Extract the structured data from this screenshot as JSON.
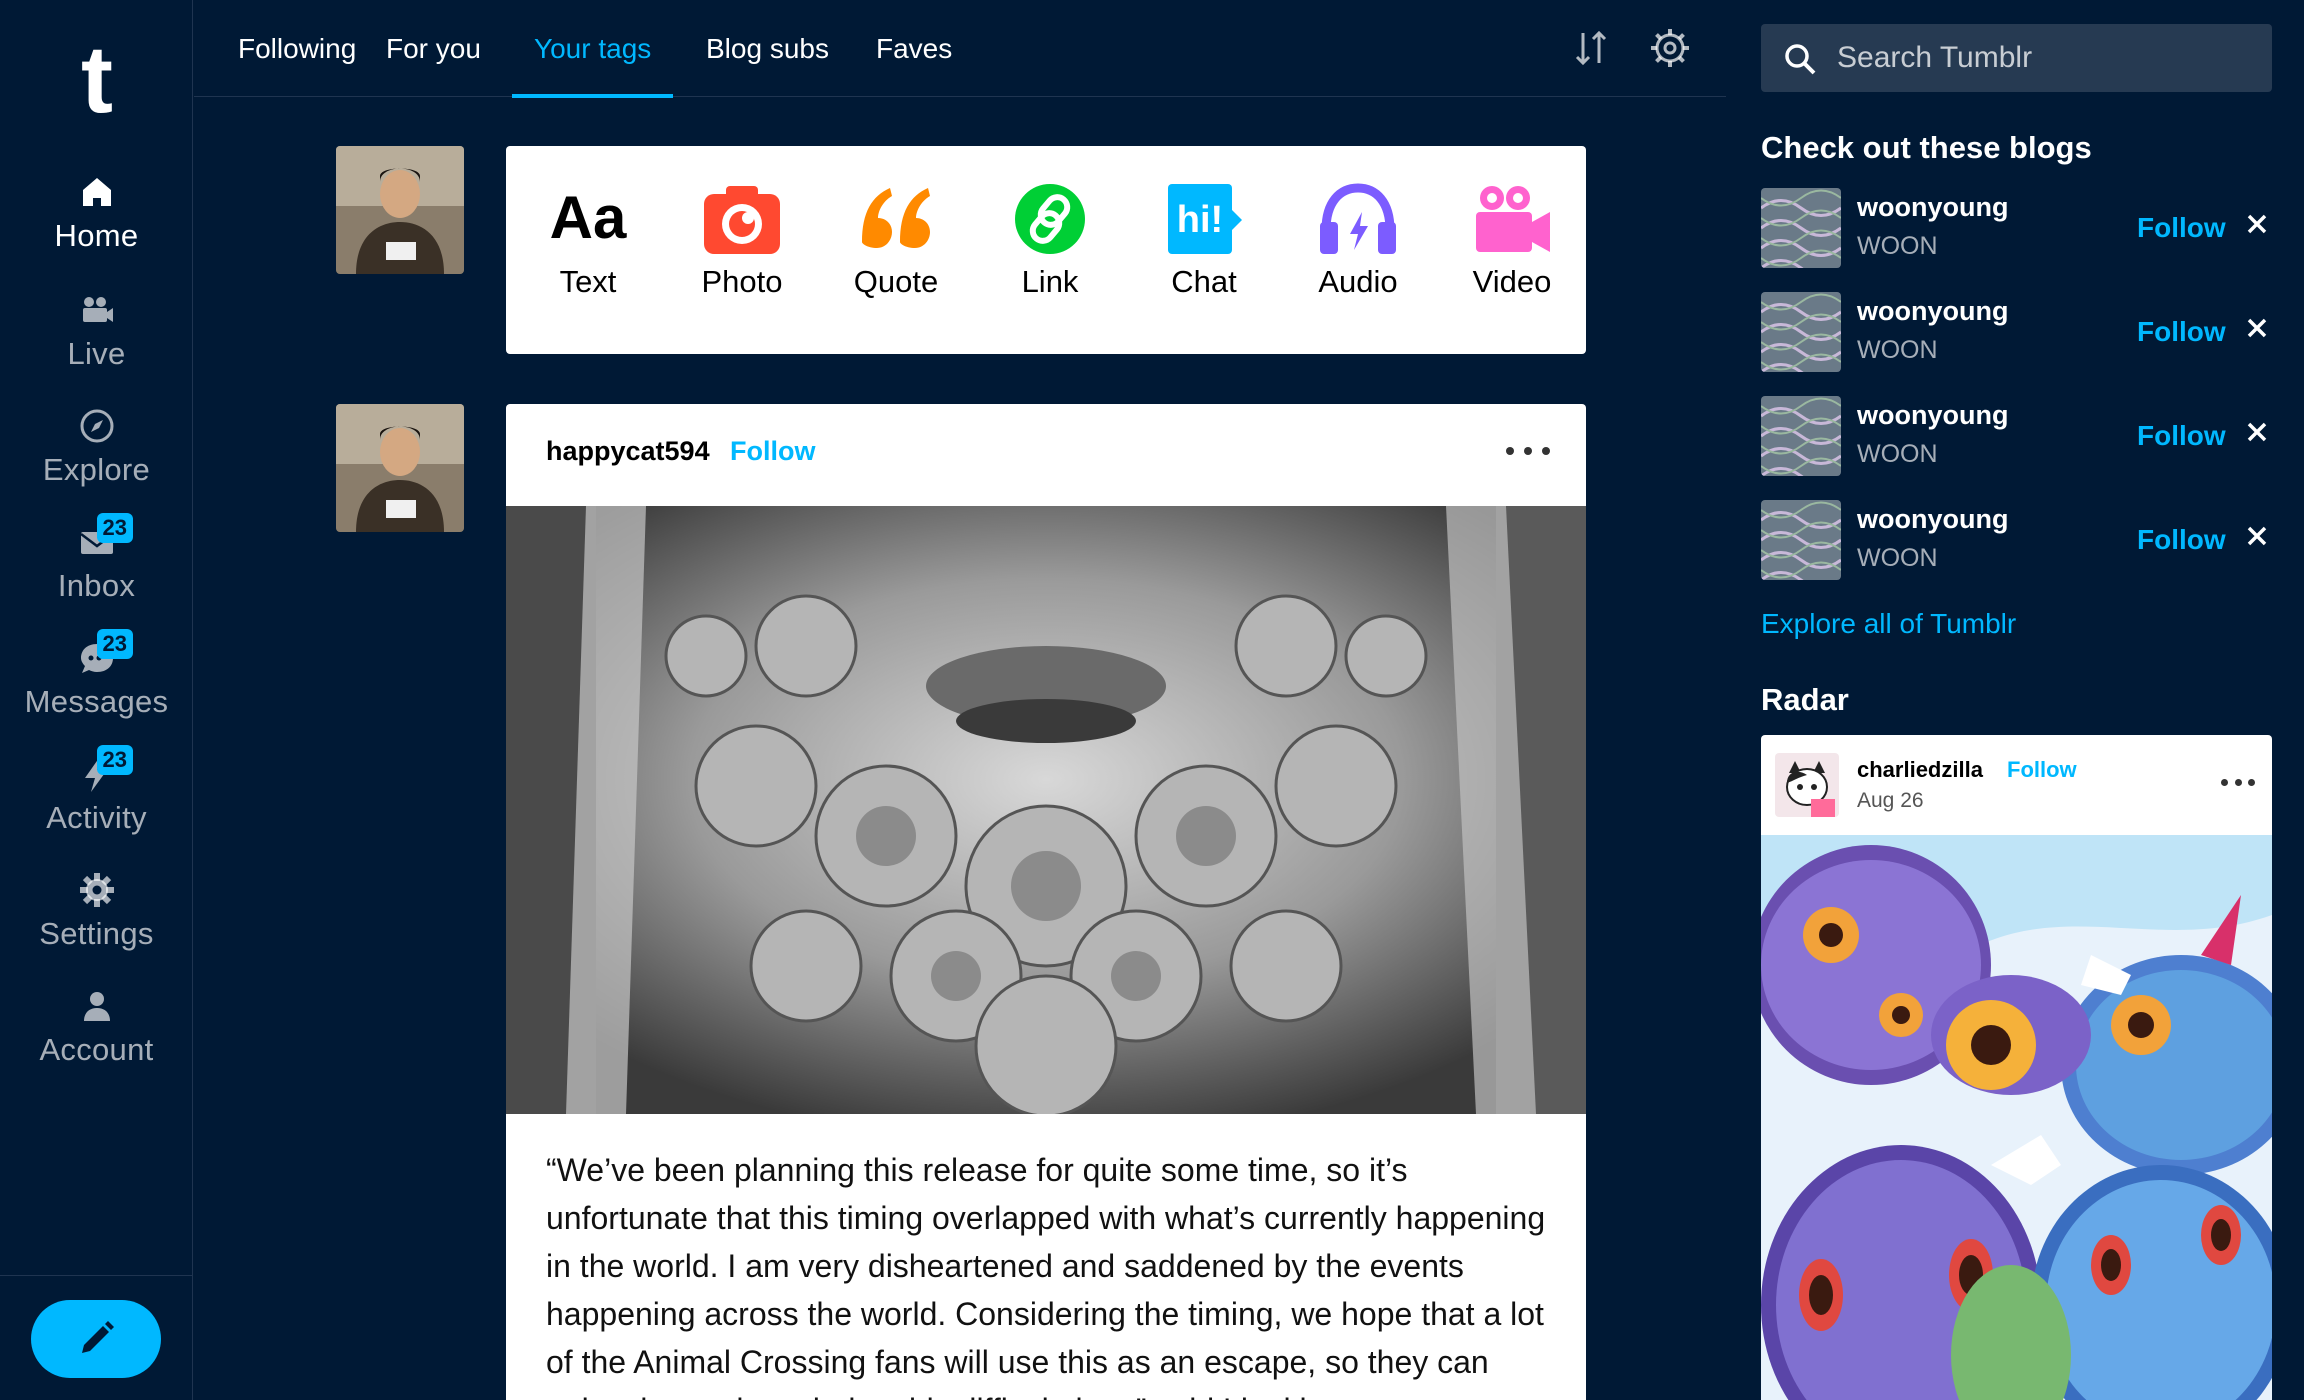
{
  "sidebar": {
    "logo": "t",
    "items": [
      {
        "label": "Home",
        "icon": "home-icon",
        "active": true
      },
      {
        "label": "Live",
        "icon": "video-camera-icon"
      },
      {
        "label": "Explore",
        "icon": "compass-icon"
      },
      {
        "label": "Inbox",
        "icon": "envelope-icon",
        "badge": "23"
      },
      {
        "label": "Messages",
        "icon": "chat-bubble-icon",
        "badge": "23"
      },
      {
        "label": "Activity",
        "icon": "lightning-icon",
        "badge": "23"
      },
      {
        "label": "Settings",
        "icon": "gear-icon"
      },
      {
        "label": "Account",
        "icon": "person-icon"
      }
    ],
    "compose_icon": "pencil-icon"
  },
  "topbar": {
    "tabs": [
      {
        "label": "Following"
      },
      {
        "label": "For you"
      },
      {
        "label": "Your tags",
        "active": true
      },
      {
        "label": "Blog subs"
      },
      {
        "label": "Faves"
      }
    ],
    "icons": [
      "sort-arrows-icon",
      "gear-icon"
    ]
  },
  "post_types": [
    {
      "label": "Text",
      "icon": "text-aa-icon",
      "color": "#000000"
    },
    {
      "label": "Photo",
      "icon": "camera-icon",
      "color": "#ff4930"
    },
    {
      "label": "Quote",
      "icon": "quote-icon",
      "color": "#ff8a00"
    },
    {
      "label": "Link",
      "icon": "link-icon",
      "color": "#00cf35"
    },
    {
      "label": "Chat",
      "icon": "chat-hi-icon",
      "color": "#00b8ff"
    },
    {
      "label": "Audio",
      "icon": "headphones-icon",
      "color": "#7c5cff"
    },
    {
      "label": "Video",
      "icon": "video-icon",
      "color": "#ff62ce"
    }
  ],
  "post": {
    "author": "happycat594",
    "follow_label": "Follow",
    "more_icon": "more-dots-icon",
    "text": "“We’ve been planning this release for quite some time, so it’s unfortunate that this timing overlapped with what’s currently happening in the world. I am very disheartened and saddened by the events happening across the world. Considering the timing, we hope that a lot of the Animal Crossing fans will use this as an escape, so they can enjoy themselves during this difficult time,” said Lin, ki"
  },
  "right": {
    "search_placeholder": "Search Tumblr",
    "blogs_title": "Check out these blogs",
    "blogs": [
      {
        "name": "woonyoung",
        "title": "WOON",
        "follow_label": "Follow"
      },
      {
        "name": "woonyoung",
        "title": "WOON",
        "follow_label": "Follow"
      },
      {
        "name": "woonyoung",
        "title": "WOON",
        "follow_label": "Follow"
      },
      {
        "name": "woonyoung",
        "title": "WOON",
        "follow_label": "Follow"
      }
    ],
    "explore_label": "Explore all of Tumblr",
    "radar_title": "Radar",
    "radar": {
      "author": "charliedzilla",
      "follow_label": "Follow",
      "date": "Aug 26"
    }
  },
  "colors": {
    "background": "#001935",
    "accent": "#00b8ff",
    "white": "#ffffff"
  }
}
